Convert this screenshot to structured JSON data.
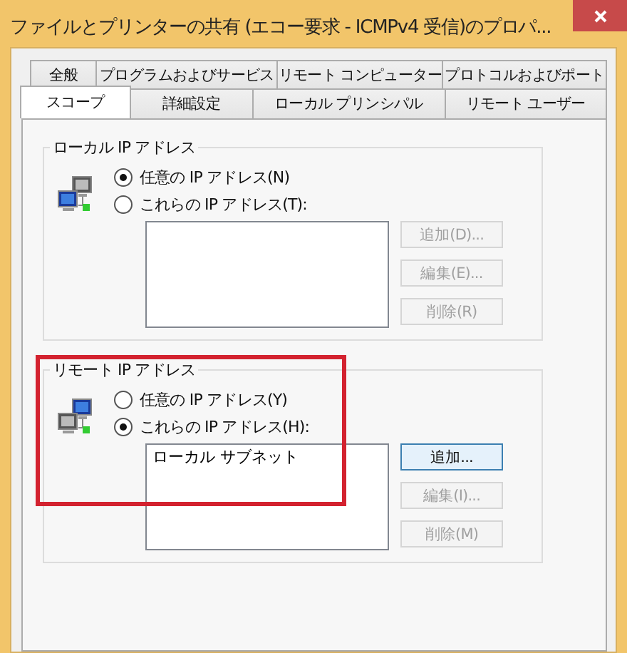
{
  "window": {
    "title": "ファイルとプリンターの共有 (エコー要求 - ICMPv4 受信)のプロパ..."
  },
  "tab_rows": [
    {
      "tabs": [
        {
          "label": "全般",
          "selected": false
        },
        {
          "label": "プログラムおよびサービス",
          "selected": false
        },
        {
          "label": "リモート コンピューター",
          "selected": false
        },
        {
          "label": "プロトコルおよびポート",
          "selected": false
        }
      ]
    },
    {
      "tabs": [
        {
          "label": "スコープ",
          "selected": true
        },
        {
          "label": "詳細設定",
          "selected": false
        },
        {
          "label": "ローカル プリンシパル",
          "selected": false
        },
        {
          "label": "リモート ユーザー",
          "selected": false
        }
      ]
    }
  ],
  "groups": [
    {
      "title": "ローカル IP アドレス",
      "highlighted": false,
      "options": [
        {
          "label": "任意の IP アドレス(N)",
          "selected": true
        },
        {
          "label": "これらの IP アドレス(T):",
          "selected": false
        }
      ],
      "buttons": [
        {
          "label": "追加(D)...",
          "disabled": true,
          "default": false
        },
        {
          "label": "編集(E)...",
          "disabled": true,
          "default": false
        },
        {
          "label": "削除(R)",
          "disabled": true,
          "default": false
        }
      ]
    },
    {
      "title": "リモート IP アドレス",
      "highlighted": true,
      "options": [
        {
          "label": "任意の IP アドレス(Y)",
          "selected": false
        },
        {
          "label": "これらの IP アドレス(H):",
          "selected": true
        }
      ],
      "addresses": [
        "ローカル サブネット"
      ],
      "buttons": [
        {
          "label": "追加...",
          "disabled": false,
          "default": true
        },
        {
          "label": "編集(I)...",
          "disabled": true,
          "default": false
        },
        {
          "label": "削除(M)",
          "disabled": true,
          "default": false
        }
      ]
    }
  ]
}
